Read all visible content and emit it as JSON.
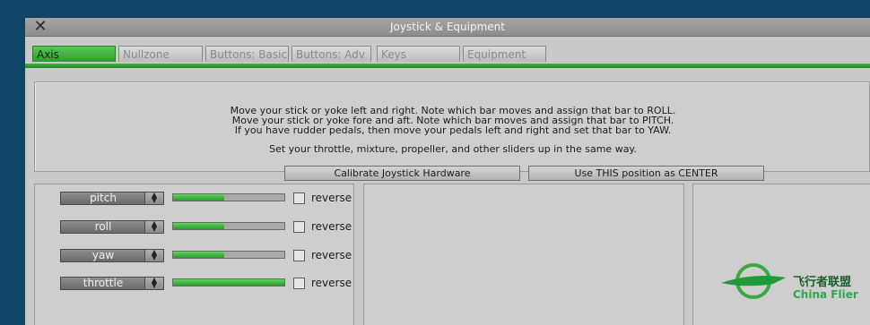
{
  "window": {
    "title": "Joystick & Equipment"
  },
  "tabs": [
    {
      "label": "Axis",
      "active": true
    },
    {
      "label": "Nullzone",
      "active": false
    },
    {
      "label": "Buttons: Basic",
      "active": false
    },
    {
      "label": "Buttons: Adv",
      "active": false
    },
    {
      "label": "Keys",
      "active": false
    },
    {
      "label": "Equipment",
      "active": false
    }
  ],
  "instructions": {
    "line1": "Move your stick or yoke left and right. Note which bar moves and assign that bar to ROLL.",
    "line2": "Move your stick or yoke fore and aft. Note which bar moves and assign that bar to PITCH.",
    "line3": "If you have rudder pedals, then move your pedals left and right and set that bar to YAW.",
    "line4": "Set your throttle, mixture, propeller, and other sliders up in the same way."
  },
  "buttons": {
    "calibrate": "Calibrate Joystick Hardware",
    "center": "Use THIS position as CENTER"
  },
  "axes": [
    {
      "name": "pitch",
      "level": 0.46,
      "reverse_label": "reverse",
      "reversed": false
    },
    {
      "name": "roll",
      "level": 0.46,
      "reverse_label": "reverse",
      "reversed": false
    },
    {
      "name": "yaw",
      "level": 0.46,
      "reverse_label": "reverse",
      "reversed": false
    },
    {
      "name": "throttle",
      "level": 1.0,
      "reverse_label": "reverse",
      "reversed": false
    }
  ],
  "logo": {
    "text_cn": "飞行者联盟",
    "text_en": "China Flier"
  },
  "colors": {
    "accent_green": "#2f9a2f",
    "background": "#0f4566",
    "panel": "#cecece"
  }
}
